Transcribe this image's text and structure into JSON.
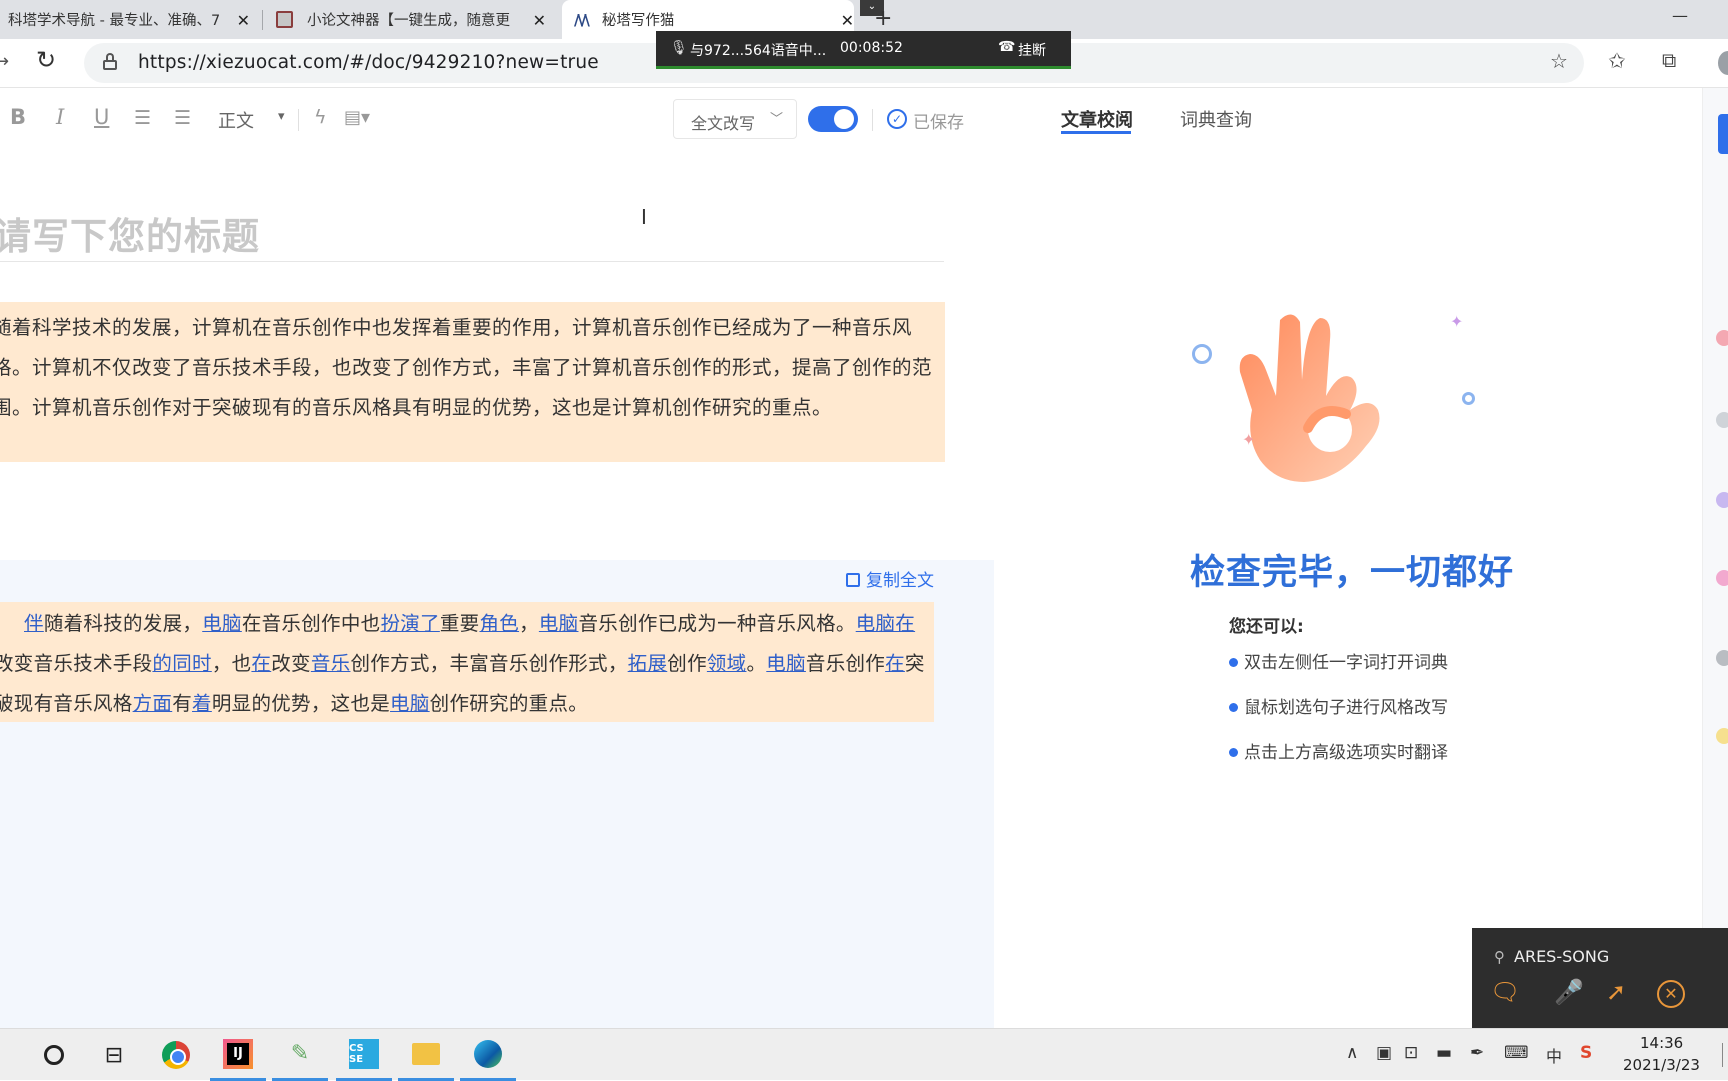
{
  "browser": {
    "tabs": [
      {
        "title": "科塔学术导航 - 最专业、准确、7",
        "active": false
      },
      {
        "title": "小论文神器【一键生成，随意更",
        "active": false
      },
      {
        "title": "秘塔写作猫",
        "active": true
      }
    ],
    "url": "https://xiezuocat.com/#/doc/9429210?new=true",
    "icons": {
      "back": "back-arrow-icon",
      "reload": "reload-icon",
      "lock": "lock-icon",
      "add_favorite": "star-add-icon",
      "favorites": "favorites-icon",
      "collections": "collections-icon"
    }
  },
  "call": {
    "text": "与972...564语音中...",
    "time": "00:08:52",
    "hangup": "挂断"
  },
  "toolbar": {
    "bold": "B",
    "italic": "I",
    "underline": "U",
    "format": "正文",
    "mode": "全文改写",
    "toggle_on": true,
    "saved": "已保存"
  },
  "panel_tabs": {
    "review": "文章校阅",
    "dictionary": "词典查询"
  },
  "editor": {
    "title_placeholder": "请写下您的标题",
    "original_text": "随着科学技术的发展，计算机在音乐创作中也发挥着重要的作用，计算机音乐创作已经成为了一种音乐风格。计算机不仅改变了音乐技术手段，也改变了创作方式，丰富了计算机音乐创作的形式，提高了创作的范围。计算机音乐创作对于突破现有的音乐风格具有明显的优势，这也是计算机创作研究的重点。",
    "copy_all": "复制全文",
    "rewritten_segments": [
      {
        "t": "伴",
        "hl": true
      },
      {
        "t": "随着科技的发展，",
        "hl": false
      },
      {
        "t": "电脑",
        "hl": true
      },
      {
        "t": "在音乐创作中也",
        "hl": false
      },
      {
        "t": "扮演了",
        "hl": true
      },
      {
        "t": "重要",
        "hl": false
      },
      {
        "t": "角色",
        "hl": true
      },
      {
        "t": "，",
        "hl": false
      },
      {
        "t": "电脑",
        "hl": true
      },
      {
        "t": "音乐创作已成为一种音乐风格。",
        "hl": false
      },
      {
        "t": "电脑在",
        "hl": true
      },
      {
        "t": "改变音乐技术手段",
        "hl": false
      },
      {
        "t": "的同时",
        "hl": true
      },
      {
        "t": "，也",
        "hl": false
      },
      {
        "t": "在",
        "hl": true
      },
      {
        "t": "改变",
        "hl": false
      },
      {
        "t": "音乐",
        "hl": true
      },
      {
        "t": "创作方式，丰富音乐创作形式，",
        "hl": false
      },
      {
        "t": "拓展",
        "hl": true
      },
      {
        "t": "创作",
        "hl": false
      },
      {
        "t": "领域",
        "hl": true
      },
      {
        "t": "。",
        "hl": false
      },
      {
        "t": "电脑",
        "hl": true
      },
      {
        "t": "音乐创作",
        "hl": false
      },
      {
        "t": "在",
        "hl": true
      },
      {
        "t": "突破现有音乐风格",
        "hl": false
      },
      {
        "t": "方面",
        "hl": true
      },
      {
        "t": "有",
        "hl": false
      },
      {
        "t": "着",
        "hl": true
      },
      {
        "t": "明显的优势，这也是",
        "hl": false
      },
      {
        "t": "电脑",
        "hl": true
      },
      {
        "t": "创作研究的重点。",
        "hl": false
      }
    ]
  },
  "review_panel": {
    "done_title": "检查完毕，一切都好",
    "can_title": "您还可以:",
    "tips": [
      "双击左侧任一字词打开词典",
      "鼠标划选句子进行风格改写",
      "点击上方高级选项实时翻译"
    ]
  },
  "remote": {
    "user": "ARES-SONG"
  },
  "taskbar": {
    "ime": "中",
    "time": "14:36",
    "date": "2021/3/23"
  },
  "colors": {
    "accent": "#2f6fea",
    "highlight_bg": "#ffe9d0",
    "result_bg": "#f3f7fd"
  }
}
